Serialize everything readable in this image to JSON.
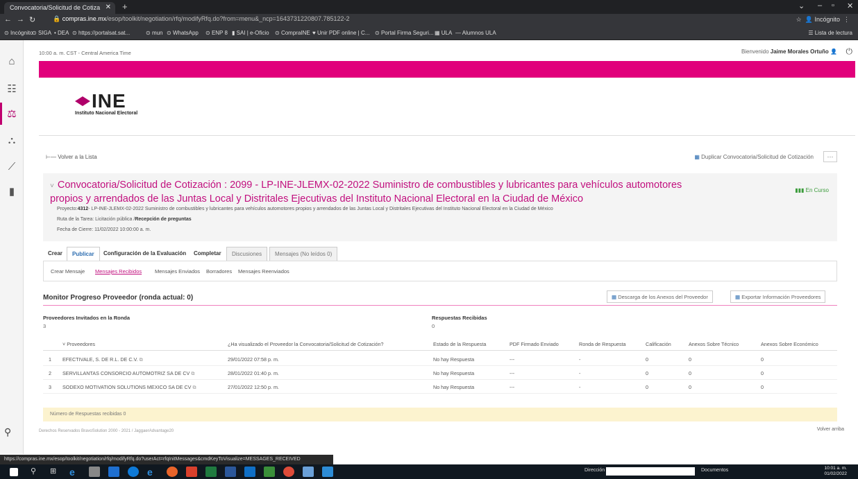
{
  "browser": {
    "tab_title": "Convocatoria/Solicitud de Cotiza",
    "url_domain": "compras.ine.mx",
    "url_rest": "/esop/toolkit/negotiation/rfq/modifyRfq.do?from=menu&_ncp=1643731220807.785122-2",
    "incognito": "Incógnito",
    "bookmarks": [
      "Incógnito",
      "SIGA",
      "DEA",
      "https://portalsat.sat...",
      "mun",
      "WhatsApp",
      "ENP 8",
      "SAI | e-Oficio",
      "CompraINE",
      "Unir PDF online | C...",
      "Portal Firma Seguri...",
      "ULA",
      "Alumnos ULA"
    ],
    "reading_list": "Lista de lectura",
    "status_url": "https://compras.ine.mx/esop/toolkit/negotiation/rfq/modifyRfq.do?userAct=rfqInitMessages&cmdKeyToVisualize=MESSAGES_RECEIVED"
  },
  "app": {
    "time": "10:00 a. m. CST - Central America Time",
    "welcome_prefix": "Bienvenido",
    "user": "Jaime Morales Ortuño",
    "logo_text": "INE",
    "logo_sub": "Instituto Nacional Electoral"
  },
  "page": {
    "back": "Volver a la Lista",
    "duplicate": "Duplicar Convocatoria/Solicitud de Cotización",
    "more": "···",
    "title": "Convocatoria/Solicitud de Cotización : 2099 - LP-INE-JLEMX-02-2022 Suministro de combustibles y lubricantes para vehículos automotores propios y arrendados de las Juntas Local y Distritales Ejecutivas del Instituto Nacional Electoral en la Ciudad de México",
    "status": "En Curso",
    "project_label": "Proyecto:",
    "project_num": "4312",
    "project_text": "- LP-INE-JLEMX-02-2022 Suministro de combustibles y lubricantes para vehículos automotores propios y arrendados de las Juntas Local y Distritales Ejecutivas del Instituto Nacional Electoral en la Ciudad de México",
    "route_label": "Ruta de la Tarea: Licitación pública /",
    "route_value": "Recepción de preguntas",
    "close_date": "Fecha de Cierre: 11/02/2022 10:00:00 a. m."
  },
  "tabs": [
    "Crear",
    "Publicar",
    "Configuración de la Evaluación",
    "Completar",
    "Discusiones",
    "Mensajes (No leídos 0)"
  ],
  "subtabs": [
    "Crear Mensaje",
    "Mensajes Recibidos",
    "Mensajes Enviados",
    "Borradores",
    "Mensajes Reenviados"
  ],
  "monitor": {
    "title": "Monitor Progreso Proveedor (ronda actual: 0)",
    "download_btn": "Descarga de los Anexos del Proveedor",
    "export_btn": "Exportar Información Proveedores",
    "invited_label": "Proveedores Invitados en la Ronda",
    "invited_value": "3",
    "responses_label": "Respuestas Recibidas",
    "responses_value": "0"
  },
  "table": {
    "headers": [
      "Proveedores",
      "¿Ha visualizado el Proveedor la Convocatoria/Solicitud de Cotización?",
      "Estado de la Respuesta",
      "PDF Firmado Enviado",
      "Ronda de Respuesta",
      "Calificación",
      "Anexos Sobre Técnico",
      "Anexos Sobre Económico"
    ],
    "rows": [
      {
        "n": "1",
        "name": "EFECTIVALE, S. DE R.L. DE C.V.",
        "seen": "29/01/2022 07:58 p. m.",
        "state": "No hay Respuesta",
        "pdf": "---",
        "round": "-",
        "score": "0",
        "tech": "0",
        "econ": "0"
      },
      {
        "n": "2",
        "name": "SERVILLANTAS CONSORCIO AUTOMOTRIZ SA DE CV",
        "seen": "28/01/2022 01:40 p. m.",
        "state": "No hay Respuesta",
        "pdf": "---",
        "round": "-",
        "score": "0",
        "tech": "0",
        "econ": "0"
      },
      {
        "n": "3",
        "name": "SODEXO MOTIVATION SOLUTIONS MEXICO SA DE CV",
        "seen": "27/01/2022 12:50 p. m.",
        "state": "No hay Respuesta",
        "pdf": "---",
        "round": "-",
        "score": "0",
        "tech": "0",
        "econ": "0"
      }
    ],
    "footer": "Número de Respuestas recibidas 0"
  },
  "footer": {
    "copyright": "Derechos Reservados BravoSolution 2000 - 2021 / JaggaerAdvantage20",
    "top": "Volver arriba"
  },
  "taskbar": {
    "direccion": "Dirección",
    "documentos": "Documentos",
    "time": "10:01 a. m.",
    "date": "01/02/2022"
  }
}
